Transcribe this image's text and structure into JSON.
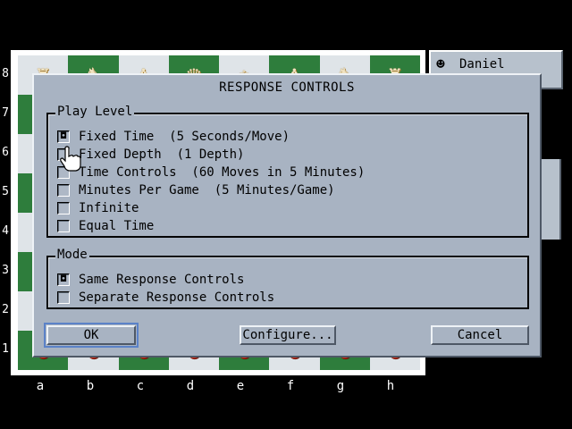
{
  "board": {
    "ranks": [
      "8",
      "7",
      "6",
      "5",
      "4",
      "3",
      "2",
      "1"
    ],
    "files": [
      "a",
      "b",
      "c",
      "d",
      "e",
      "f",
      "g",
      "h"
    ],
    "top_row": [
      "♜",
      "♞",
      "♝",
      "♛",
      "♚",
      "♝",
      "♞",
      "♜"
    ],
    "bottom_row": [
      "●",
      "●",
      "●",
      "●",
      "●",
      "●",
      "●",
      "●"
    ]
  },
  "player": {
    "name": "Daniel",
    "icon": "robot-icon"
  },
  "dialog": {
    "title": "RESPONSE CONTROLS",
    "play_level": {
      "legend": "Play Level",
      "options": [
        {
          "label": "Fixed Time  (5 Seconds/Move)",
          "checked": true
        },
        {
          "label": "Fixed Depth  (1 Depth)",
          "checked": false
        },
        {
          "label": "Time Controls  (60 Moves in 5 Minutes)",
          "checked": false
        },
        {
          "label": "Minutes Per Game  (5 Minutes/Game)",
          "checked": false
        },
        {
          "label": "Infinite",
          "checked": false
        },
        {
          "label": "Equal Time",
          "checked": false
        }
      ]
    },
    "mode": {
      "legend": "Mode",
      "options": [
        {
          "label": "Same Response Controls",
          "checked": true
        },
        {
          "label": "Separate Response Controls",
          "checked": false
        }
      ]
    },
    "buttons": {
      "ok": "OK",
      "configure": "Configure...",
      "cancel": "Cancel"
    }
  },
  "colors": {
    "dialog": "#a8b3c2",
    "light_square": "#dfe4e8",
    "dark_square": "#2e7d3c",
    "focus": "#5b82c8"
  }
}
